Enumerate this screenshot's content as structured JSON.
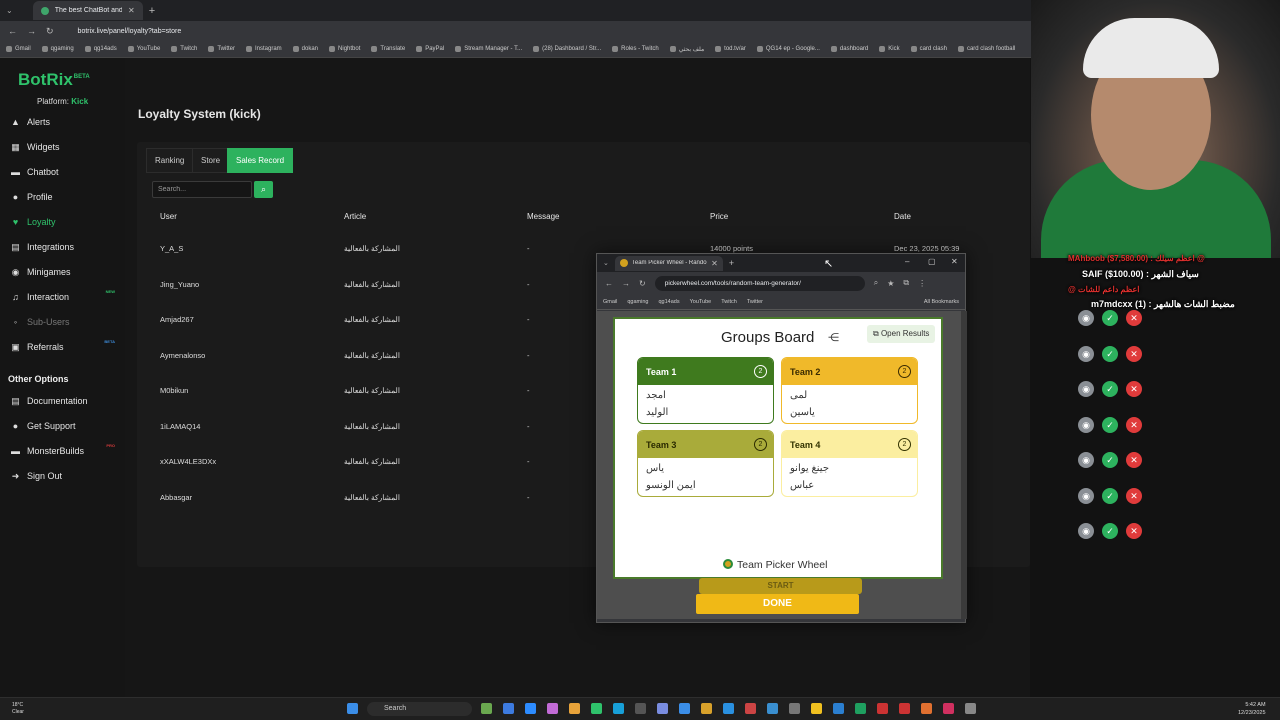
{
  "browser": {
    "tab_title": "The best ChatBot and Widgets",
    "url": "botrix.live/panel/loyalty?tab=store",
    "bookmarks": [
      "Gmail",
      "qgaming",
      "qg14ads",
      "YouTube",
      "Twitch",
      "Twitter",
      "Instagram",
      "dokan",
      "Nightbot",
      "Translate",
      "PayPal",
      "Stream Manager - T...",
      "(28) Dashboard / Str...",
      "Roles - Twitch",
      "ملف بحثي",
      "tod.tv/ar",
      "QG14 ep - Google...",
      "dashboard",
      "Kick",
      "card clash",
      "card clash football"
    ]
  },
  "sidebar": {
    "logo": "BotRix",
    "logo_badge": "BETA",
    "platform_label": "Platform:",
    "platform_value": "Kick",
    "items": [
      {
        "label": "Alerts",
        "icon": "alert-icon"
      },
      {
        "label": "Widgets",
        "icon": "widgets-icon"
      },
      {
        "label": "Chatbot",
        "icon": "chatbot-icon"
      },
      {
        "label": "Profile",
        "icon": "profile-icon"
      },
      {
        "label": "Loyalty",
        "icon": "loyalty-icon"
      },
      {
        "label": "Integrations",
        "icon": "integrations-icon"
      },
      {
        "label": "Minigames",
        "icon": "minigames-icon"
      },
      {
        "label": "Interaction",
        "icon": "interaction-icon",
        "badge": "NEW"
      },
      {
        "label": "Sub-Users",
        "icon": "subusers-icon"
      },
      {
        "label": "Referrals",
        "icon": "referrals-icon",
        "badge": "BETA"
      }
    ],
    "other_title": "Other Options",
    "other_items": [
      {
        "label": "Documentation",
        "icon": "docs-icon"
      },
      {
        "label": "Get Support",
        "icon": "support-icon"
      },
      {
        "label": "MonsterBuilds",
        "icon": "monster-icon",
        "badge": "PRO"
      },
      {
        "label": "Sign Out",
        "icon": "signout-icon"
      }
    ]
  },
  "main": {
    "title": "Loyalty System (kick)",
    "tabs": [
      "Ranking",
      "Store",
      "Sales Record"
    ],
    "search_placeholder": "Search...",
    "columns": [
      "User",
      "Article",
      "Message",
      "Price",
      "Date"
    ],
    "rows": [
      {
        "user": "Y_A_S",
        "article": "المشاركة بالفعالية",
        "message": "-",
        "price": "14000 points",
        "date": "Dec 23, 2025 05:39"
      },
      {
        "user": "Jing_Yuano",
        "article": "المشاركة بالفعالية",
        "message": "-"
      },
      {
        "user": "Amjad267",
        "article": "المشاركة بالفعالية",
        "message": "-"
      },
      {
        "user": "Aymenalonso",
        "article": "المشاركة بالفعالية",
        "message": "-"
      },
      {
        "user": "M0bikun",
        "article": "المشاركة بالفعالية",
        "message": "-"
      },
      {
        "user": "1iLAMAQ14",
        "article": "المشاركة بالفعالية",
        "message": "-"
      },
      {
        "user": "xXALW4LE3DXx",
        "article": "المشاركة بالفعالية",
        "message": "-"
      },
      {
        "user": "Abbasgar",
        "article": "المشاركة بالفعالية",
        "message": "-"
      }
    ]
  },
  "popup": {
    "tab_title": "Team Picker Wheel - Random",
    "url": "pickerwheel.com/tools/random-team-generator/",
    "bookmarks": [
      "Gmail",
      "qgaming",
      "qg14ads",
      "YouTube",
      "Twitch",
      "Twitter"
    ],
    "all_bookmarks": "All Bookmarks",
    "board_title": "Groups Board",
    "open_results": "Open Results",
    "teams": [
      {
        "name": "Team 1",
        "count": "2",
        "members": [
          "امجد",
          "الوليد"
        ],
        "head": "#3f7a1e",
        "headText": "#ffffff",
        "border": "#3f7a1e"
      },
      {
        "name": "Team 2",
        "count": "2",
        "members": [
          "لمى",
          "ياسين"
        ],
        "head": "#f0b92a",
        "headText": "#3a2a00",
        "border": "#f0b92a"
      },
      {
        "name": "Team 3",
        "count": "2",
        "members": [
          "ياس",
          "ايمن الونسو"
        ],
        "head": "#a9ab3a",
        "headText": "#2a2a00",
        "border": "#a9ab3a"
      },
      {
        "name": "Team 4",
        "count": "2",
        "members": [
          "جينغ يوانو",
          "عباس"
        ],
        "head": "#fbeea0",
        "headText": "#333300",
        "border": "#fbeea0"
      }
    ],
    "brand": "Team Picker Wheel",
    "start": "START",
    "done": "DONE"
  },
  "stream_overlay": {
    "line1": "SAIF ($100.00) : سياف الشهر",
    "line2": "m7mdcxx (1) : مضبط الشات هالشهر",
    "red1": "MAhboob ($7,580.00) : اعظم سيلك @",
    "red2": "@ اعظم داعم للشات"
  },
  "taskbar": {
    "temp": "18°C",
    "weather": "Clear",
    "search": "Search",
    "time": "5:42 AM",
    "date": "12/23/2025"
  }
}
